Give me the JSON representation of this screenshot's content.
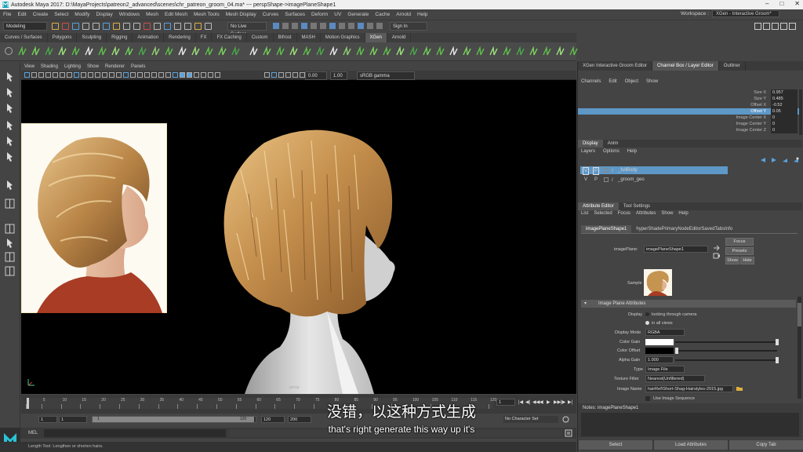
{
  "title_bar": {
    "title": "Autodesk Maya 2017: D:\\MayaProjects\\patreon2_advanced\\scenes\\chr_patreon_groom_04.ma* --- perspShape->imagePlaneShape1"
  },
  "menus": [
    "File",
    "Edit",
    "Create",
    "Select",
    "Modify",
    "Display",
    "Windows",
    "Mesh",
    "Edit Mesh",
    "Mesh Tools",
    "Mesh Display",
    "Curves",
    "Surfaces",
    "Deform",
    "UV",
    "Generate",
    "Cache",
    "Arnold",
    "Help"
  ],
  "workspace": {
    "label": "Workspace :",
    "value": "XGen - Interactive Groom*"
  },
  "status_line": {
    "mode": "Modeling",
    "live_surface": "No Live Surface",
    "sign_in": "Sign In"
  },
  "shelf_tabs": [
    "Curves / Surfaces",
    "Polygons",
    "Sculpting",
    "Rigging",
    "Animation",
    "Rendering",
    "FX",
    "FX Caching",
    "Custom",
    "Bifrost",
    "MASH",
    "Motion Graphics",
    "XGen",
    "Arnold"
  ],
  "shelf_active": "XGen",
  "viewport": {
    "menus": [
      "View",
      "Shading",
      "Lighting",
      "Show",
      "Renderer",
      "Panels"
    ],
    "exposure": "0.00",
    "gamma": "1.00",
    "color_space": "sRGB gamma",
    "camera_label": "persp"
  },
  "timeline": {
    "ticks": [
      "1",
      "5",
      "10",
      "15",
      "20",
      "25",
      "30",
      "35",
      "40",
      "45",
      "50",
      "55",
      "60",
      "65",
      "70",
      "75",
      "80",
      "85",
      "90",
      "95",
      "100",
      "105",
      "110",
      "115",
      "120"
    ],
    "current_frame": "1"
  },
  "range": {
    "start": "1",
    "anim_start": "1",
    "slider_start": "1",
    "slider_end": "120",
    "end": "120",
    "anim_end": "200",
    "character_set": "No Character Set"
  },
  "mel": {
    "label": "MEL"
  },
  "help_line": "Length Tool: Lengthen or shorten hairs.",
  "subtitles": {
    "zh": "没错，以这种方式生成",
    "en": "that's right generate this way up it's"
  },
  "right_panel": {
    "top_tabs": [
      "XGen Interactive Groom Editor",
      "Channel Box / Layer Editor",
      "Outliner"
    ],
    "channel_menu": [
      "Channels",
      "Edit",
      "Object",
      "Show"
    ],
    "channels": [
      {
        "name": "Size X",
        "value": "0.957"
      },
      {
        "name": "Size Y",
        "value": "0.485"
      },
      {
        "name": "Offset X",
        "value": "-0.52"
      },
      {
        "name": "Offset Y",
        "value": "0.05"
      },
      {
        "name": "Image Center X",
        "value": "0"
      },
      {
        "name": "Image Center Y",
        "value": "0"
      },
      {
        "name": "Image Center Z",
        "value": "0"
      }
    ],
    "layer_tabs": [
      "Display",
      "Anim"
    ],
    "layer_menu": [
      "Layers",
      "Options",
      "Help"
    ],
    "layers": [
      {
        "v": "V",
        "p": "P",
        "name": "_fullBody"
      },
      {
        "v": "V",
        "p": "P",
        "name": "_groom_geo"
      }
    ],
    "ae_tabs": [
      "Attribute Editor",
      "Tool Settings"
    ],
    "ae_menu": [
      "List",
      "Selected",
      "Focus",
      "Attributes",
      "Show",
      "Help"
    ],
    "node_tabs": [
      "imagePlaneShape1",
      "hyperShadePrimaryNodeEditorSavedTabsInfo"
    ],
    "image_plane_label": "imagePlane:",
    "image_plane_value": "imagePlaneShape1",
    "buttons": {
      "focus": "Focus",
      "presets": "Presets",
      "show": "Show",
      "hide": "Hide"
    },
    "sample_label": "Sample",
    "section": "Image Plane Attributes",
    "display_label": "Display",
    "display_opt1": "looking through camera",
    "display_opt2": "in all views",
    "display_mode_label": "Display Mode",
    "display_mode": "RGBA",
    "color_gain": "Color Gain",
    "color_offset": "Color Offset",
    "alpha_gain_label": "Alpha Gain",
    "alpha_gain": "1.000",
    "type_label": "Type",
    "type": "Image File",
    "texture_filter_label": "Texture Filter",
    "texture_filter": "Nearest(Unfiltered)",
    "image_name_label": "Image Name",
    "image_name": "hairRef\\Short-Shag-Hairstyles-2015.jpg",
    "use_sequence": "Use Image Sequence",
    "notes": "Notes: imagePlaneShape1",
    "bottom_buttons": [
      "Select",
      "Load Attributes",
      "Copy Tab"
    ]
  },
  "colors": {
    "selection": "#5e98c7",
    "layer_selected": "#5e98c7",
    "bg": "#444444",
    "viewport": "#000000"
  }
}
